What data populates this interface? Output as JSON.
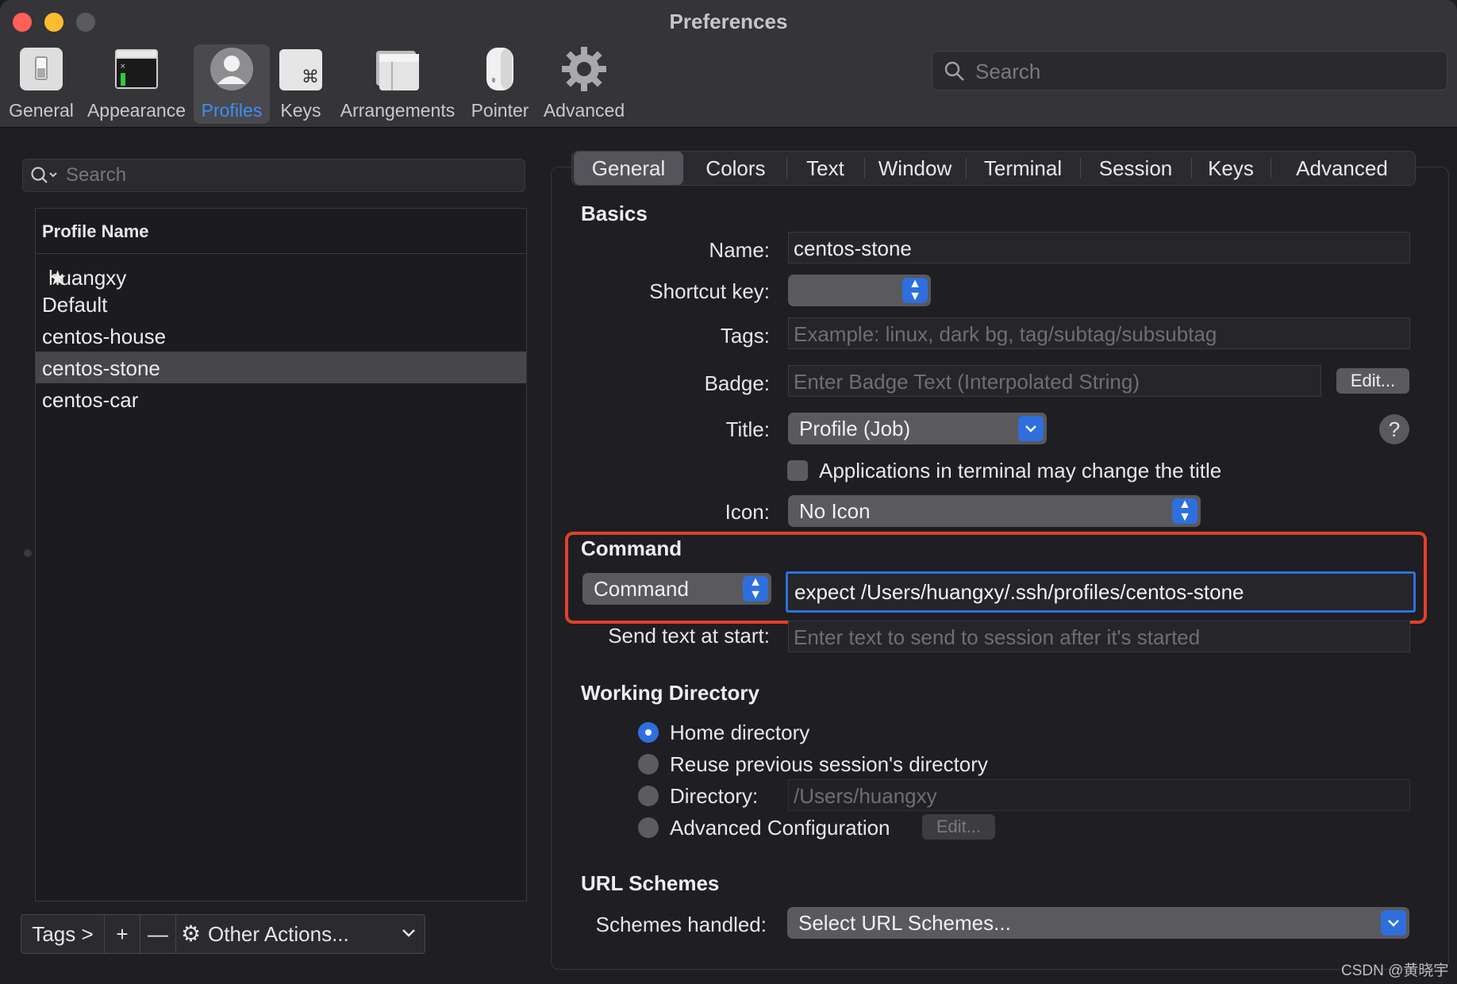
{
  "window": {
    "title": "Preferences"
  },
  "toolbar": {
    "items": [
      {
        "label": "General",
        "icon": "general-icon"
      },
      {
        "label": "Appearance",
        "icon": "appearance-icon"
      },
      {
        "label": "Profiles",
        "icon": "profiles-icon"
      },
      {
        "label": "Keys",
        "icon": "keys-icon"
      },
      {
        "label": "Arrangements",
        "icon": "arrangements-icon"
      },
      {
        "label": "Pointer",
        "icon": "pointer-icon"
      },
      {
        "label": "Advanced",
        "icon": "advanced-gear-icon"
      }
    ],
    "active": "Profiles",
    "search_placeholder": "Search"
  },
  "profiles": {
    "search_placeholder": "Search",
    "column_header": "Profile Name",
    "rows": [
      "huangxy",
      "Default",
      "centos-house",
      "centos-stone",
      "centos-car"
    ],
    "default_row": "huangxy",
    "selected": "centos-stone",
    "tags_button": "Tags >",
    "add_button": "+",
    "remove_button": "—",
    "other_actions": "Other Actions..."
  },
  "tabs": {
    "items": [
      "General",
      "Colors",
      "Text",
      "Window",
      "Terminal",
      "Session",
      "Keys",
      "Advanced"
    ],
    "active": "General"
  },
  "basics": {
    "heading": "Basics",
    "name_label": "Name:",
    "name_value": "centos-stone",
    "shortcut_label": "Shortcut key:",
    "shortcut_value": "",
    "tags_label": "Tags:",
    "tags_placeholder": "Example: linux, dark bg, tag/subtag/subsubtag",
    "badge_label": "Badge:",
    "badge_placeholder": "Enter Badge Text (Interpolated String)",
    "badge_edit_button": "Edit...",
    "title_label": "Title:",
    "title_value": "Profile (Job)",
    "title_help": "?",
    "change_title_checkbox": "Applications in terminal may change the title",
    "change_title_checked": false,
    "icon_label": "Icon:",
    "icon_value": "No Icon"
  },
  "command": {
    "heading": "Command",
    "mode_value": "Command",
    "command_value": "expect /Users/huangxy/.ssh/profiles/centos-stone",
    "send_text_label": "Send text at start:",
    "send_text_placeholder": "Enter text to send to session after it's started"
  },
  "working_directory": {
    "heading": "Working Directory",
    "options": [
      "Home directory",
      "Reuse previous session's directory",
      "Directory:",
      "Advanced Configuration"
    ],
    "selected": "Home directory",
    "directory_placeholder": "/Users/huangxy",
    "advanced_edit_button": "Edit..."
  },
  "url_schemes": {
    "heading": "URL Schemes",
    "schemes_label": "Schemes handled:",
    "schemes_value": "Select URL Schemes..."
  },
  "watermark": "CSDN @黄晓宇",
  "colors": {
    "accent": "#2f6fdd",
    "selection_text": "#3d8ef4",
    "highlight_box": "#e0402c"
  }
}
